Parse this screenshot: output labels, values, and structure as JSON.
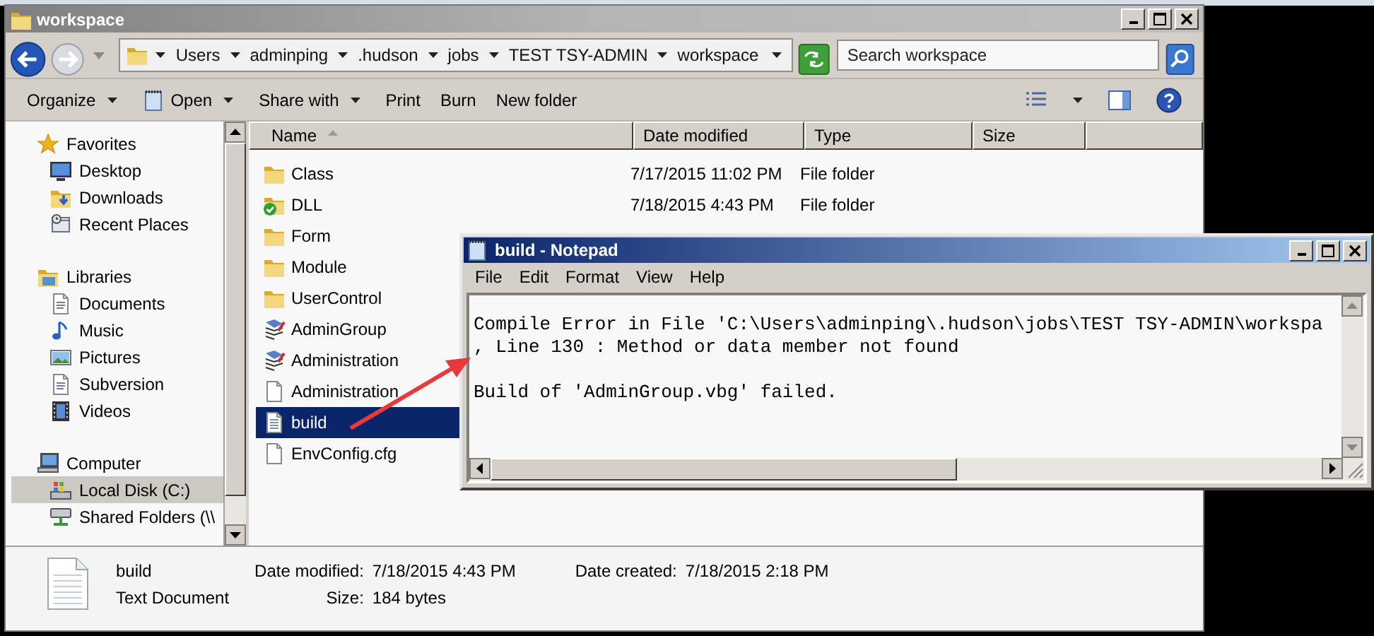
{
  "window": {
    "title": "workspace"
  },
  "address_bar": {
    "crumbs": [
      "Users",
      "adminping",
      ".hudson",
      "jobs",
      "TEST TSY-ADMIN",
      "workspace"
    ]
  },
  "search": {
    "placeholder": "Search workspace"
  },
  "toolbar": [
    {
      "label": "Organize",
      "dropdown": true,
      "icon": false
    },
    {
      "label": "Open",
      "dropdown": true,
      "icon": true
    },
    {
      "label": "Share with",
      "dropdown": true,
      "icon": false
    },
    {
      "label": "Print",
      "dropdown": false,
      "icon": false
    },
    {
      "label": "Burn",
      "dropdown": false,
      "icon": false
    },
    {
      "label": "New folder",
      "dropdown": false,
      "icon": false
    }
  ],
  "navigation": [
    {
      "label": "Favorites",
      "kind": "star",
      "children": [
        {
          "label": "Desktop",
          "kind": "desktop",
          "selected": false
        },
        {
          "label": "Downloads",
          "kind": "downloads",
          "selected": false
        },
        {
          "label": "Recent Places",
          "kind": "recent",
          "selected": false
        }
      ]
    },
    {
      "label": "Libraries",
      "kind": "library",
      "children": [
        {
          "label": "Documents",
          "kind": "documents",
          "selected": false
        },
        {
          "label": "Music",
          "kind": "music",
          "selected": false
        },
        {
          "label": "Pictures",
          "kind": "pictures",
          "selected": false
        },
        {
          "label": "Subversion",
          "kind": "documents",
          "selected": false
        },
        {
          "label": "Videos",
          "kind": "videos",
          "selected": false
        }
      ]
    },
    {
      "label": "Computer",
      "kind": "computer",
      "children": [
        {
          "label": "Local Disk (C:)",
          "kind": "disk",
          "selected": true
        },
        {
          "label": "Shared Folders (\\\\",
          "kind": "network",
          "selected": false
        }
      ]
    }
  ],
  "columns": [
    {
      "label": "Name",
      "sorted": true
    },
    {
      "label": "Date modified",
      "sorted": false
    },
    {
      "label": "Type",
      "sorted": false
    },
    {
      "label": "Size",
      "sorted": false
    }
  ],
  "files": [
    {
      "name": "Class",
      "kind": "folder",
      "date_modified": "7/17/2015 11:02 PM",
      "type": "File folder",
      "selected": false
    },
    {
      "name": "DLL",
      "kind": "folder-check",
      "date_modified": "7/18/2015 4:43 PM",
      "type": "File folder",
      "selected": false
    },
    {
      "name": "Form",
      "kind": "folder",
      "selected": false
    },
    {
      "name": "Module",
      "kind": "folder",
      "selected": false
    },
    {
      "name": "UserControl",
      "kind": "folder",
      "selected": false
    },
    {
      "name": "AdminGroup",
      "kind": "project",
      "selected": false
    },
    {
      "name": "Administration",
      "kind": "project",
      "selected": false
    },
    {
      "name": "Administration",
      "kind": "file",
      "selected": false
    },
    {
      "name": "build",
      "kind": "text",
      "selected": true
    },
    {
      "name": "EnvConfig.cfg",
      "kind": "file",
      "selected": false
    }
  ],
  "details": {
    "name": "build",
    "type": "Text Document",
    "fields": [
      {
        "label": "Date modified:",
        "value": "7/18/2015 4:43 PM"
      },
      {
        "label": "Date created:",
        "value": "7/18/2015 2:18 PM"
      },
      {
        "label": "Size:",
        "value": "184 bytes"
      }
    ]
  },
  "notepad": {
    "title": "build - Notepad",
    "menu": [
      "File",
      "Edit",
      "Format",
      "View",
      "Help"
    ],
    "text": "Compile Error in File 'C:\\Users\\adminping\\.hudson\\jobs\\TEST TSY-ADMIN\\workspa\n, Line 130 : Method or data member not found\n\nBuild of 'AdminGroup.vbg' failed."
  }
}
